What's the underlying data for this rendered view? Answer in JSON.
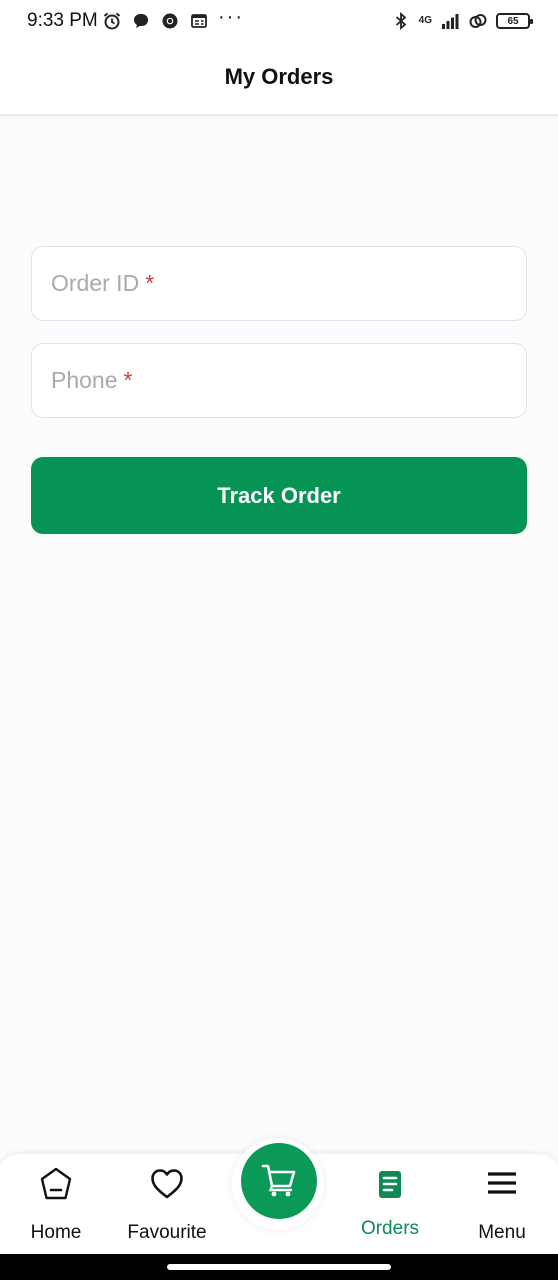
{
  "status_bar": {
    "time": "9:33 PM",
    "left_icons": [
      "alarm-icon",
      "chat-bubble-icon",
      "chrome-icon",
      "news-icon"
    ],
    "more": "···",
    "network": "4G",
    "right_icons": [
      "bluetooth-icon",
      "signal-icon",
      "sync-icon"
    ],
    "battery": "65"
  },
  "header": {
    "title": "My Orders"
  },
  "form": {
    "order_id_placeholder": "Order ID",
    "phone_placeholder": "Phone",
    "required_mark": "*",
    "track_button_label": "Track Order"
  },
  "bottom_nav": {
    "items": [
      {
        "label": "Home",
        "icon": "home-icon"
      },
      {
        "label": "Favourite",
        "icon": "heart-icon"
      },
      {
        "label": "Cart",
        "icon": "cart-icon"
      },
      {
        "label": "Orders",
        "icon": "orders-document-icon",
        "active": true
      },
      {
        "label": "Menu",
        "icon": "hamburger-menu-icon"
      }
    ],
    "active_color": "#0e8a55",
    "fab_color": "#0b9957"
  },
  "colors": {
    "primary": "#059455",
    "required": "#c94242",
    "background": "#fcfbfd"
  }
}
